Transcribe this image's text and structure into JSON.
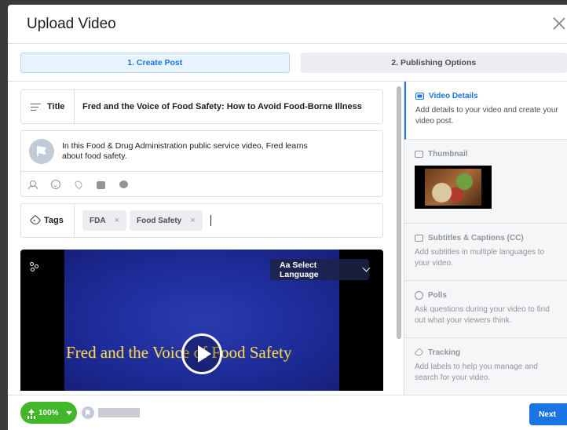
{
  "dialog": {
    "title": "Upload Video"
  },
  "steps": [
    {
      "label": "1. Create Post",
      "active": true
    },
    {
      "label": "2. Publishing Options",
      "active": false
    }
  ],
  "post": {
    "title_label": "Title",
    "title_value": "Fred and the Voice of Food Safety: How to Avoid Food-Borne Illness",
    "description": "In this Food & Drug Administration public service video, Fred learns about food safety.",
    "description_icons": [
      "tag-people-icon",
      "feeling-icon",
      "location-icon",
      "shop-icon",
      "messenger-icon"
    ],
    "tags_label": "Tags",
    "tags": [
      "FDA",
      "Food Safety"
    ],
    "tag_remove": "×"
  },
  "video": {
    "select_language_label": "Aa Select Language",
    "caption": "Fred and the Voice of Food Safety"
  },
  "sidebar": {
    "sections": [
      {
        "title": "Video Details",
        "description": "Add details to your video and create your video post.",
        "icon": "video-details-icon",
        "active": true
      },
      {
        "title": "Thumbnail",
        "description": "",
        "icon": "image-icon",
        "active": false
      },
      {
        "title": "Subtitles & Captions (CC)",
        "description": "Add subtitles in multiple languages to your video.",
        "icon": "cc-icon",
        "active": false
      },
      {
        "title": "Polls",
        "description": "Ask questions during your video to find out what your viewers think.",
        "icon": "poll-icon",
        "active": false
      },
      {
        "title": "Tracking",
        "description": "Add labels to help you manage and search for your video.",
        "icon": "tag-icon",
        "active": false
      }
    ]
  },
  "footer": {
    "upload_progress": "100%",
    "next_label": "Next"
  },
  "colors": {
    "accent": "#1b74e4",
    "success": "#42b72a"
  }
}
